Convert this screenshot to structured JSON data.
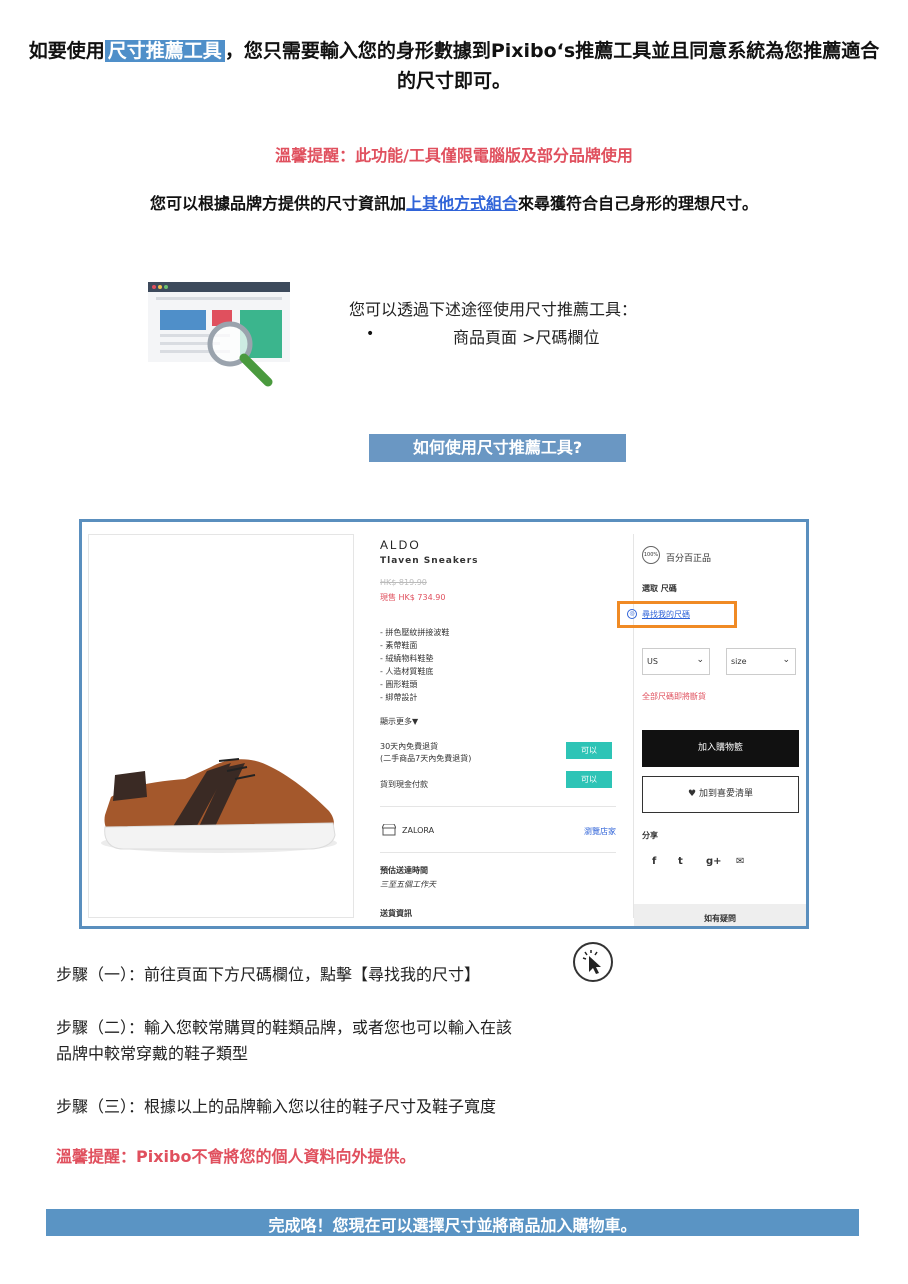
{
  "intro": {
    "part1": "如要使用",
    "highlight": "尺寸推薦工具",
    "part2": "，您只需要輸入您的身形數據到Pixibo‘s推薦工具並且同意系統為您推薦適合的尺寸即可。"
  },
  "tip1": "溫馨提醒：此功能/工具僅限電腦版及部分品牌使用",
  "desc": {
    "part1": "您可以根據品牌方提供的尺寸資訊加",
    "link": "上其他方式組合",
    "part2": "來尋獲符合自己身形的理想尺寸。"
  },
  "via": {
    "label": "您可以透過下述途徑使用尺寸推薦工具：",
    "bullet": "•",
    "item": "商品頁面 >尺碼欄位"
  },
  "howto_banner": "如何使用尺寸推薦工具?",
  "product": {
    "brand": "ALDO",
    "name": "Tlaven Sneakers",
    "old_price": "HK$ 819.90",
    "new_price": "現售 HK$ 734.90",
    "features": [
      "- 拼色壓紋拼接波鞋",
      "- 素帶鞋面",
      "- 絨繞物料鞋墊",
      "- 人造材質鞋底",
      "- 圓形鞋頭",
      "- 綁帶設計"
    ],
    "show_more": "顯示更多▼",
    "return_line1": "30天內免費退貨",
    "return_line2": "(二手商品7天內免費退貨)",
    "return_pill": "可以",
    "cod": "貨到現金付款",
    "cod_pill": "可以",
    "store": "ZALORA",
    "visit_store": "瀏覽店家",
    "eta_label": "預估送達時間",
    "eta_value": "三至五個工作天",
    "shipping": "送貨資訊"
  },
  "sidebar": {
    "authentic_badge": "100%",
    "authentic": "百分百正品",
    "select_size": "選取 尺碼",
    "find_my_size": "尋找我的尺碼",
    "region": "US",
    "size": "size",
    "all_sizes": "全部尺碼即將斷貨",
    "add_to_cart": "加入購物籃",
    "wishlist": "加到喜愛清單",
    "share": "分享",
    "social": [
      "f",
      "t",
      "g+",
      "✉"
    ],
    "faq": "如有疑問"
  },
  "steps": {
    "step1": "步驟（一）：前往頁面下方尺碼欄位，點擊【尋找我的尺寸】",
    "step2_line1": "步驟（二）：輸入您較常購買的鞋類品牌，或者您也可以輸入在該",
    "step2_line2": "品牌中較常穿戴的鞋子類型",
    "step3": "步驟（三）：根據以上的品牌輸入您以往的鞋子尺寸及鞋子寬度"
  },
  "tip2": "溫馨提醒：Pixibo不會將您的個人資料向外提供。",
  "done_banner": "完成咯！您現在可以選擇尺寸並將商品加入購物車。",
  "colors": {
    "accent_blue": "#5a94c4",
    "warning_red": "#e0505e",
    "highlight_orange": "#f08a24",
    "teal": "#2ec4b6"
  }
}
